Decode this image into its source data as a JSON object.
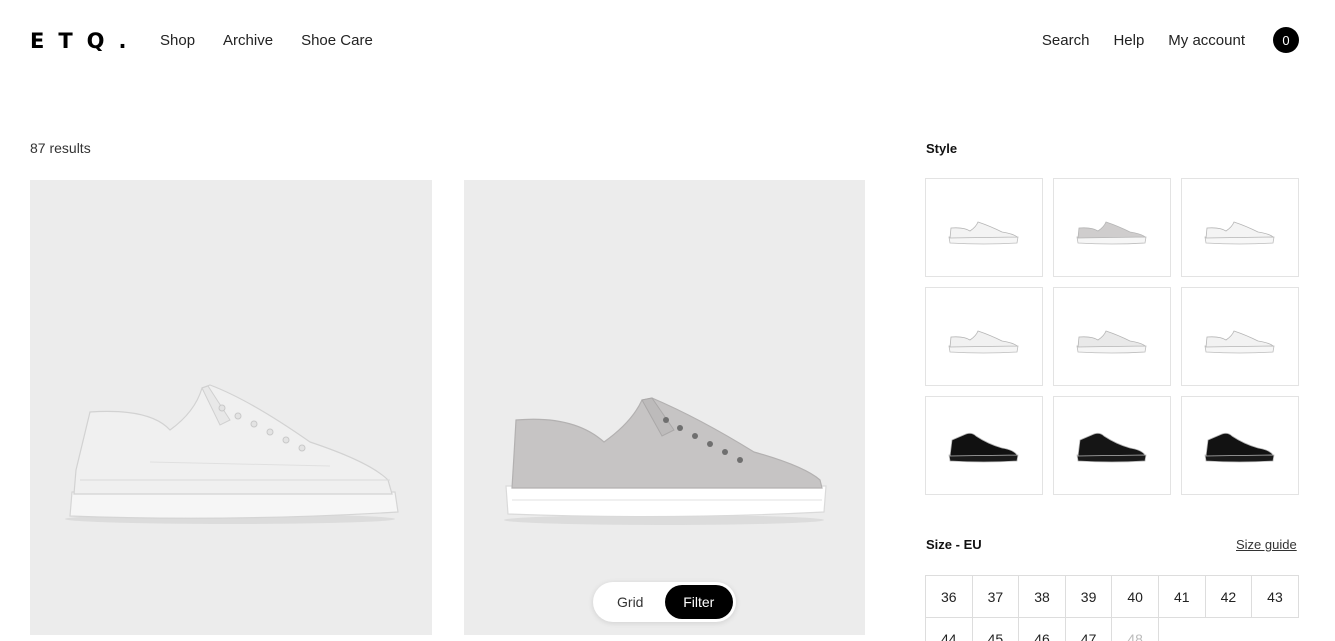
{
  "header": {
    "logo": "ETQ.",
    "nav": [
      "Shop",
      "Archive",
      "Shoe Care"
    ],
    "right_nav": [
      "Search",
      "Help",
      "My account"
    ],
    "cart_count": "0"
  },
  "results": {
    "count_label": "87 results"
  },
  "products": [
    {
      "color": "#f2f2f2",
      "sole": "#f4f4f4"
    },
    {
      "color": "#c6c4c4",
      "sole": "#ffffff"
    }
  ],
  "toggle": {
    "grid_label": "Grid",
    "filter_label": "Filter"
  },
  "sidebar": {
    "style_title": "Style",
    "styles": [
      {
        "upper": "#f3f3f3",
        "sole": "#f6f6f6"
      },
      {
        "upper": "#cfcdcd",
        "sole": "#f6f6f6"
      },
      {
        "upper": "#f4f4f4",
        "sole": "#f7f7f7"
      },
      {
        "upper": "#f1f1f1",
        "sole": "#f5f5f5"
      },
      {
        "upper": "#e9e9e9",
        "sole": "#f5f5f5"
      },
      {
        "upper": "#f2f2f2",
        "sole": "#f6f6f6"
      },
      {
        "upper": "#111111",
        "sole": "#1a1a1a"
      },
      {
        "upper": "#151515",
        "sole": "#1a1a1a"
      },
      {
        "upper": "#121212",
        "sole": "#1a1a1a"
      }
    ],
    "size_title": "Size - EU",
    "size_guide": "Size guide",
    "sizes": [
      "36",
      "37",
      "38",
      "39",
      "40",
      "41",
      "42",
      "43",
      "44",
      "45",
      "46",
      "47",
      "48"
    ],
    "disabled_sizes": [
      "48"
    ]
  }
}
